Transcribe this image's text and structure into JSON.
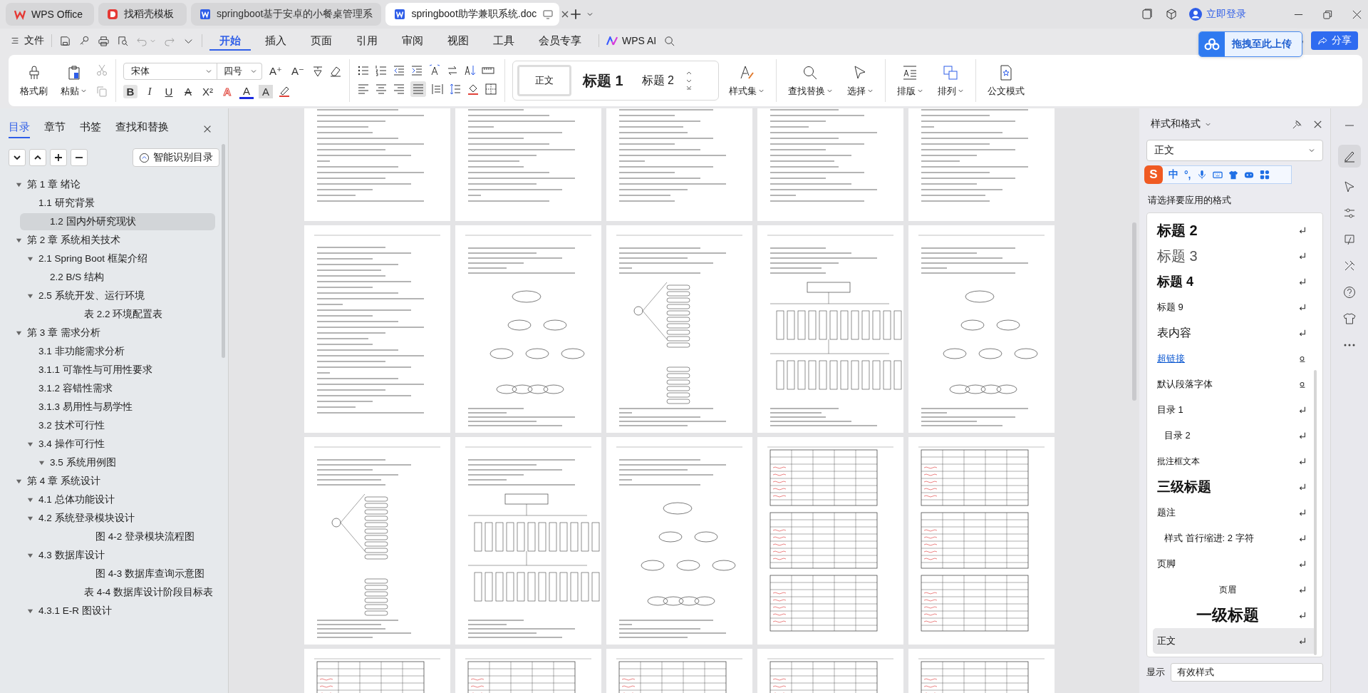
{
  "tabs": [
    {
      "label": "WPS Office",
      "kind": "wps",
      "selected": false
    },
    {
      "label": "找稻壳模板",
      "kind": "docer",
      "selected": false
    },
    {
      "label": "springboot基于安卓的小餐桌管理系",
      "kind": "doc",
      "selected": false
    },
    {
      "label": "springboot助学兼职系统.doc",
      "kind": "doc",
      "selected": true
    }
  ],
  "account": "立即登录",
  "menu": {
    "file": "文件",
    "ai": "WPS AI",
    "tabs": [
      {
        "label": "开始",
        "selected": true
      },
      {
        "label": "插入",
        "selected": false
      },
      {
        "label": "页面",
        "selected": false
      },
      {
        "label": "引用",
        "selected": false
      },
      {
        "label": "审阅",
        "selected": false
      },
      {
        "label": "视图",
        "selected": false
      },
      {
        "label": "工具",
        "selected": false
      },
      {
        "label": "会员专享",
        "selected": false
      }
    ]
  },
  "upload": "拖拽至此上传",
  "share": "分享",
  "ribbon": {
    "painter": "格式刷",
    "paste": "粘贴",
    "font": "宋体",
    "size": "四号",
    "font_row1": [
      {
        "glyph": "A⁺"
      },
      {
        "glyph": "A⁻"
      }
    ],
    "font_row2": [
      {
        "glyph": "B",
        "kind": "bold",
        "on": true
      },
      {
        "glyph": "I",
        "kind": "italic",
        "on": false
      },
      {
        "glyph": "U",
        "kind": "underline",
        "on": false
      },
      {
        "glyph": "A",
        "kind": "strike",
        "on": false
      },
      {
        "glyph": "X²",
        "kind": "superscript",
        "on": false
      },
      {
        "glyph": "A",
        "kind": "effect",
        "on": false
      },
      {
        "glyph": "A",
        "kind": "color",
        "on": false
      },
      {
        "glyph": "A",
        "kind": "shading",
        "on": false
      }
    ],
    "styles": [
      {
        "label": "正文",
        "kind": "body",
        "selected": true
      },
      {
        "label": "标题  1",
        "kind": "h1",
        "selected": false
      },
      {
        "label": "标题  2",
        "kind": "h2",
        "selected": false
      }
    ],
    "style_set": "样式集",
    "find": "查找替换",
    "select": "选择",
    "layout": "排版",
    "arrange": "排列",
    "official": "公文模式"
  },
  "nav": {
    "tabs": [
      {
        "label": "目录",
        "selected": true
      },
      {
        "label": "章节",
        "selected": false
      },
      {
        "label": "书签",
        "selected": false
      },
      {
        "label": "查找和替换",
        "selected": false
      }
    ],
    "smart": "智能识别目录",
    "tree": [
      {
        "label": "第 1 章   绪论",
        "kind": "heading",
        "expanded": true,
        "selected": false,
        "children": [
          {
            "label": "1.1   研究背景",
            "kind": "heading",
            "selected": false
          },
          {
            "label": "1.2   国内外研究现状",
            "kind": "heading",
            "selected": true
          }
        ]
      },
      {
        "label": "第 2 章   系统相关技术",
        "kind": "heading",
        "expanded": true,
        "selected": false,
        "children": [
          {
            "label": "2.1 Spring Boot 框架介绍",
            "kind": "heading",
            "expanded": true,
            "selected": false,
            "children": [
              {
                "label": "2.2   B/S 结构",
                "kind": "heading",
                "selected": false
              }
            ]
          },
          {
            "label": "2.5   系统开发、运行环境",
            "kind": "heading",
            "expanded": true,
            "selected": false,
            "children": [
              {
                "label": "表 2.2   环境配置表",
                "kind": "table",
                "selected": false
              }
            ]
          }
        ]
      },
      {
        "label": "第 3 章   需求分析",
        "kind": "heading",
        "expanded": true,
        "selected": false,
        "children": [
          {
            "label": "3.1   非功能需求分析",
            "kind": "heading",
            "selected": false
          },
          {
            "label": "3.1.1   可靠性与可用性要求",
            "kind": "heading",
            "selected": false
          },
          {
            "label": "3.1.2   容错性需求",
            "kind": "heading",
            "selected": false
          },
          {
            "label": "3.1.3   易用性与易学性",
            "kind": "heading",
            "selected": false
          },
          {
            "label": "3.2   技术可行性",
            "kind": "heading",
            "selected": false
          },
          {
            "label": "3.4   操作可行性",
            "kind": "heading",
            "expanded": true,
            "selected": false,
            "children": [
              {
                "label": "3.5 系统用例图",
                "kind": "heading",
                "expanded": true,
                "selected": false
              }
            ]
          }
        ]
      },
      {
        "label": "第 4 章   系统设计",
        "kind": "heading",
        "expanded": true,
        "selected": false,
        "children": [
          {
            "label": "4.1   总体功能设计",
            "kind": "heading",
            "expanded": true,
            "selected": false
          },
          {
            "label": "4.2   系统登录模块设计",
            "kind": "heading",
            "expanded": true,
            "selected": false,
            "children": [
              {
                "label": "图 4-2   登录模块流程图",
                "kind": "figure",
                "selected": false
              }
            ]
          },
          {
            "label": "4.3   数据库设计",
            "kind": "heading",
            "expanded": true,
            "selected": false,
            "children": [
              {
                "label": "图 4-3   数据库查询示意图",
                "kind": "figure",
                "selected": false
              },
              {
                "label": "表 4-4   数据库设计阶段目标表",
                "kind": "table",
                "selected": false
              }
            ]
          },
          {
            "label": "4.3.1   E-R 图设计",
            "kind": "heading",
            "expanded": true,
            "selected": false
          }
        ]
      }
    ]
  },
  "pages": [
    {
      "kind": "text"
    },
    {
      "kind": "text"
    },
    {
      "kind": "text"
    },
    {
      "kind": "text"
    },
    {
      "kind": "text"
    },
    {
      "kind": "text"
    },
    {
      "kind": "diagram"
    },
    {
      "kind": "diagram"
    },
    {
      "kind": "diagram"
    },
    {
      "kind": "diagram"
    },
    {
      "kind": "diagram"
    },
    {
      "kind": "diagram"
    },
    {
      "kind": "diagram"
    },
    {
      "kind": "table"
    },
    {
      "kind": "table"
    },
    {
      "kind": "table"
    },
    {
      "kind": "table"
    },
    {
      "kind": "table"
    },
    {
      "kind": "table"
    },
    {
      "kind": "table"
    }
  ],
  "ime": {
    "logo": "S",
    "mode": "中",
    "punct": "°,"
  },
  "styles_panel": {
    "title": "样式和格式",
    "current": "正文",
    "prompt": "请选择要应用的格式",
    "items": [
      {
        "label": "标题  2",
        "kind": "h2",
        "character_style": false,
        "selected": false
      },
      {
        "label": "标题  3",
        "kind": "h3",
        "character_style": false,
        "selected": false
      },
      {
        "label": "标题  4",
        "kind": "h4",
        "character_style": false,
        "selected": false
      },
      {
        "label": "标题  9",
        "kind": "small",
        "character_style": false,
        "selected": false
      },
      {
        "label": "表内容",
        "kind": "medium",
        "character_style": false,
        "selected": false
      },
      {
        "label": "超链接",
        "kind": "link",
        "character_style": true,
        "selected": false
      },
      {
        "label": "默认段落字体",
        "kind": "small",
        "character_style": true,
        "selected": false
      },
      {
        "label": "目录  1",
        "kind": "small",
        "character_style": false,
        "selected": false
      },
      {
        "label": "目录  2",
        "kind": "indent",
        "character_style": false,
        "selected": false
      },
      {
        "label": "批注框文本",
        "kind": "tiny",
        "character_style": false,
        "selected": false
      },
      {
        "label": "三级标题",
        "kind": "big",
        "character_style": false,
        "selected": false
      },
      {
        "label": "题注",
        "kind": "small",
        "character_style": false,
        "selected": false
      },
      {
        "label": "样式  首行缩进:   2  字符",
        "kind": "indent",
        "character_style": false,
        "selected": false
      },
      {
        "label": "页脚",
        "kind": "small",
        "character_style": false,
        "selected": false
      },
      {
        "label": "页眉",
        "kind": "center",
        "character_style": false,
        "selected": false
      },
      {
        "label": "一级标题",
        "kind": "title",
        "character_style": false,
        "selected": false
      },
      {
        "label": "正文",
        "kind": "small",
        "character_style": false,
        "selected": true
      }
    ],
    "show_label": "显示",
    "show_value": "有效样式"
  }
}
